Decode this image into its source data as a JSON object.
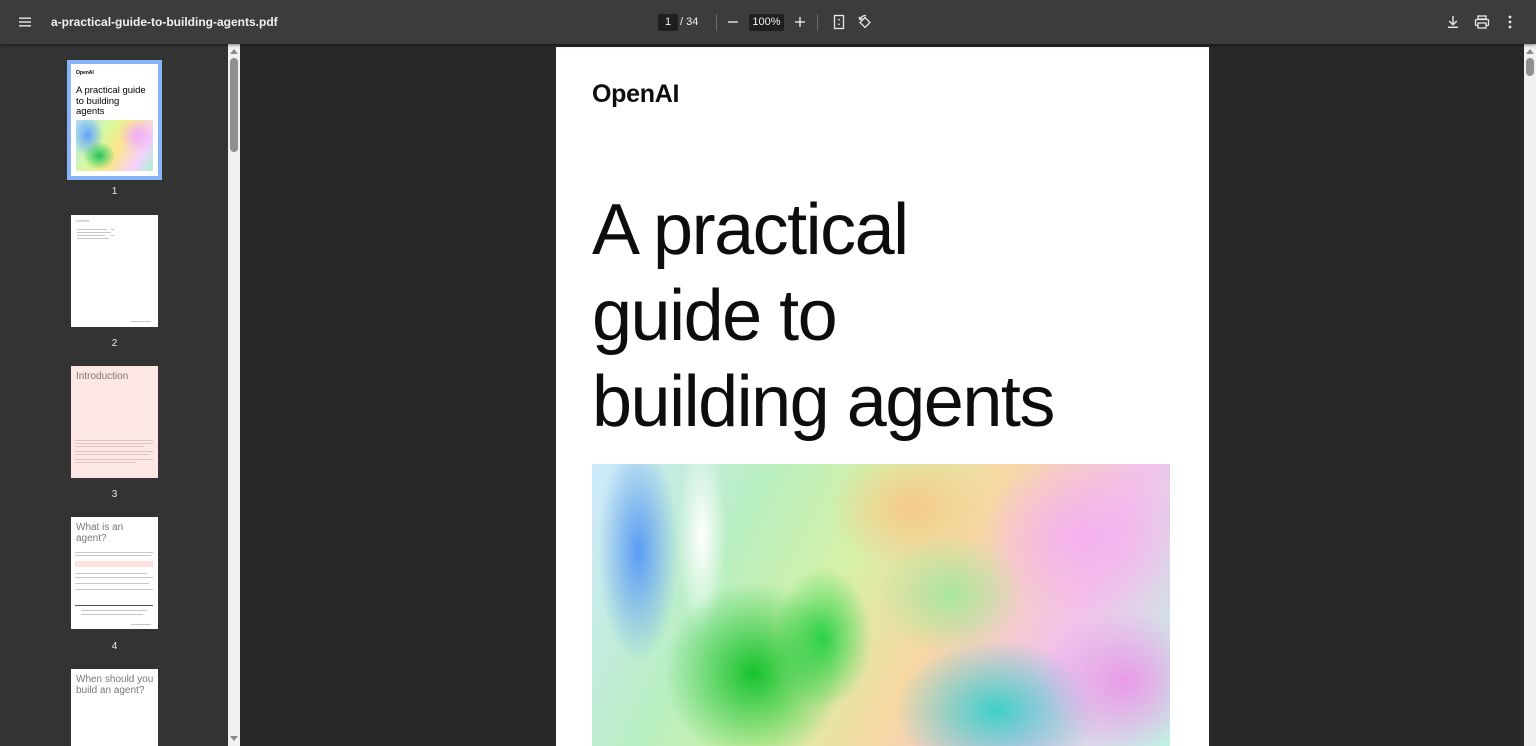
{
  "toolbar": {
    "menu_icon": "hamburger-menu-icon",
    "title": "a-practical-guide-to-building-agents.pdf",
    "page_current": "1",
    "page_total": "/ 34",
    "zoom_level": "100%",
    "icons": [
      "zoom-out-icon",
      "zoom-in-icon",
      "fit-page-icon",
      "rotate-icon",
      "download-icon",
      "print-icon",
      "more-options-icon"
    ]
  },
  "sidebar": {
    "thumbnails": [
      {
        "number": "1",
        "logo": "OpenAI",
        "title": "A practical guide to building agents"
      },
      {
        "number": "2",
        "heading": "Contents"
      },
      {
        "number": "3",
        "heading": "Introduction"
      },
      {
        "number": "4",
        "heading": "What is an agent?"
      },
      {
        "number": "5",
        "heading": "When should you build an agent?"
      }
    ]
  },
  "page": {
    "logo": "OpenAI",
    "title_lines": [
      "A practical",
      "guide to",
      "building agents"
    ]
  },
  "colors": {
    "toolbar_bg": "#3c3c3c",
    "sidebar_bg": "#333333",
    "viewer_bg": "#282828",
    "selected_outline": "#8ab4f8",
    "intro_thumb_bg": "#fde7e5"
  }
}
